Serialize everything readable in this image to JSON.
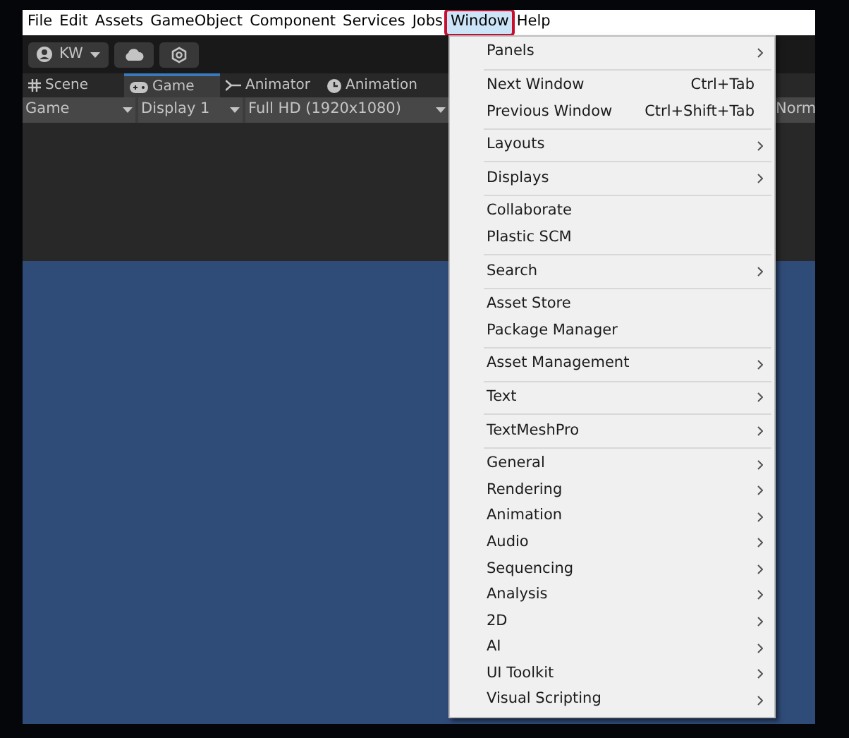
{
  "menu_bar": [
    {
      "label": "File",
      "selected": false
    },
    {
      "label": "Edit",
      "selected": false
    },
    {
      "label": "Assets",
      "selected": false
    },
    {
      "label": "GameObject",
      "selected": false
    },
    {
      "label": "Component",
      "selected": false
    },
    {
      "label": "Services",
      "selected": false
    },
    {
      "label": "Jobs",
      "selected": false
    },
    {
      "label": "Window",
      "selected": true,
      "highlighted": true
    },
    {
      "label": "Help",
      "selected": false
    }
  ],
  "toolbar": {
    "account": "KW"
  },
  "tabs": [
    {
      "label": "Scene",
      "selected": false
    },
    {
      "label": "Game",
      "selected": true
    },
    {
      "label": "Animator",
      "selected": false
    },
    {
      "label": "Animation",
      "selected": false
    }
  ],
  "game_toolbar": [
    {
      "label": "Game"
    },
    {
      "label": "Display 1"
    },
    {
      "label": "Full HD (1920x1080)"
    },
    {
      "label": "Norm"
    }
  ],
  "window_menu": [
    [
      {
        "label": "Panels",
        "submenu": true
      }
    ],
    [
      {
        "label": "Next Window",
        "shortcut": "Ctrl+Tab",
        "submenu": false
      },
      {
        "label": "Previous Window",
        "shortcut": "Ctrl+Shift+Tab",
        "submenu": false
      }
    ],
    [
      {
        "label": "Layouts",
        "submenu": true
      }
    ],
    [
      {
        "label": "Displays",
        "submenu": true
      }
    ],
    [
      {
        "label": "Collaborate",
        "submenu": false
      },
      {
        "label": "Plastic SCM",
        "submenu": false
      }
    ],
    [
      {
        "label": "Search",
        "submenu": true
      }
    ],
    [
      {
        "label": "Asset Store",
        "submenu": false
      },
      {
        "label": "Package Manager",
        "submenu": false
      }
    ],
    [
      {
        "label": "Asset Management",
        "submenu": true
      }
    ],
    [
      {
        "label": "Text",
        "submenu": true
      }
    ],
    [
      {
        "label": "TextMeshPro",
        "submenu": true
      }
    ],
    [
      {
        "label": "General",
        "submenu": true
      },
      {
        "label": "Rendering",
        "submenu": true
      },
      {
        "label": "Animation",
        "submenu": true
      },
      {
        "label": "Audio",
        "submenu": true
      },
      {
        "label": "Sequencing",
        "submenu": true
      },
      {
        "label": "Analysis",
        "submenu": true
      },
      {
        "label": "2D",
        "submenu": true
      },
      {
        "label": "AI",
        "submenu": true
      },
      {
        "label": "UI Toolkit",
        "submenu": true
      },
      {
        "label": "Visual Scripting",
        "submenu": true
      }
    ]
  ]
}
